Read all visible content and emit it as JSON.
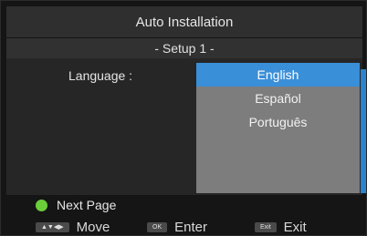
{
  "window": {
    "title": "Auto Installation",
    "step": "- Setup 1 -"
  },
  "form": {
    "language_label": "Language :",
    "language_options": [
      "English",
      "Español",
      "Português"
    ],
    "selected_language": "English"
  },
  "colors": {
    "selected": "#3a8fd9",
    "dropdown_bg": "#7d7d7d",
    "green_button": "#6ccd3a"
  },
  "footer": {
    "next_page": "Next Page",
    "move_key": "▲▼◀▶",
    "move_label": "Move",
    "enter_key": "OK",
    "enter_label": "Enter",
    "exit_key": "Exit",
    "exit_label": "Exit"
  }
}
